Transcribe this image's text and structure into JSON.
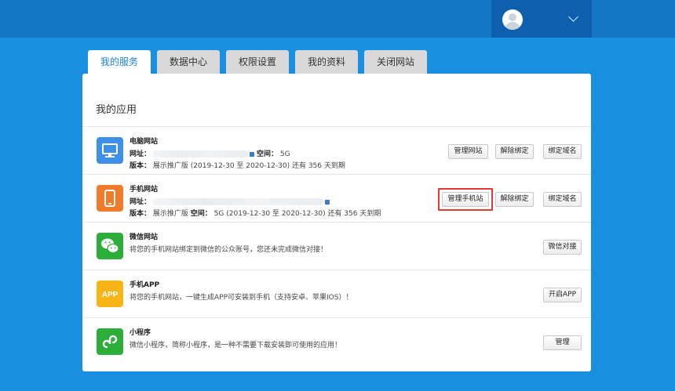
{
  "tabs": [
    "我的服务",
    "数据中心",
    "权限设置",
    "我的资料",
    "关闭网站"
  ],
  "panel": {
    "title": "我的应用"
  },
  "apps": {
    "pc": {
      "name": "电脑网站",
      "url_label": "网址：",
      "space_label": "空间：",
      "space_value": "5G",
      "version_label": "版本：",
      "version_text": "展示推广版 (2019-12-30 至 2020-12-30) 还有 356 天到期",
      "buttons": [
        "管理网站",
        "解除绑定",
        "绑定域名"
      ]
    },
    "mobile": {
      "name": "手机网站",
      "url_label": "网址：",
      "version_label": "版本：",
      "version_text": "展示推广版",
      "space_label": "空间：",
      "space_text": "5G (2019-12-30 至 2020-12-30) 还有 356 天到期",
      "buttons": [
        "管理手机站",
        "解除绑定",
        "绑定域名"
      ]
    },
    "wechat": {
      "name": "微信网站",
      "desc": "将您的手机网站绑定到微信的公众账号，您还未完成微信对接！",
      "button": "微信对接"
    },
    "app": {
      "name": "手机APP",
      "desc": "将您的手机网站，一键生成APP可安装到手机（支持安卓、苹果IOS）！",
      "button": "开启APP",
      "icon_text": "APP"
    },
    "mini": {
      "name": "小程序",
      "desc": "微信小程序，简称小程序，是一种不需要下载安装即可使用的应用！",
      "button": "管理"
    }
  },
  "colors": {
    "header": "#1376c6",
    "background": "#1a8fe0",
    "pc_icon": "#3d8fe8",
    "mobile_icon": "#f07b2a",
    "wechat_icon": "#2dae3b",
    "app_icon": "#f7b417",
    "mini_icon": "#2dae3b",
    "highlight": "#e53935"
  },
  "icons": {
    "user": "avatar-icon",
    "dropdown": "chevron-down-icon",
    "pc": "monitor-icon",
    "mobile": "phone-icon",
    "wechat": "wechat-icon",
    "app": "app-icon",
    "mini": "mini-program-icon"
  }
}
